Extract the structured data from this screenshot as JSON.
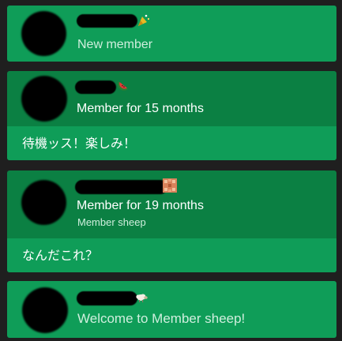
{
  "colors": {
    "background": "#1f1f1f",
    "card_light": "#0f9d58",
    "card_dark": "#0b8043",
    "text_primary": "#ffffff",
    "text_secondary": "#cfeedd"
  },
  "events": [
    {
      "type": "new-member",
      "badge_icon": "party-popper-icon",
      "status": "New member"
    },
    {
      "type": "member-message",
      "badge_icon": "watermelon-icon",
      "status": "Member for 15 months",
      "message": "待機ッス！楽しみ！"
    },
    {
      "type": "member-message",
      "badge_icon": "pixel-badge-icon",
      "status": "Member for 19 months",
      "level": "Member sheep",
      "message": "なんだこれ？"
    },
    {
      "type": "new-member",
      "badge_icon": "sheep-icon",
      "status": "Welcome to Member sheep!"
    }
  ]
}
